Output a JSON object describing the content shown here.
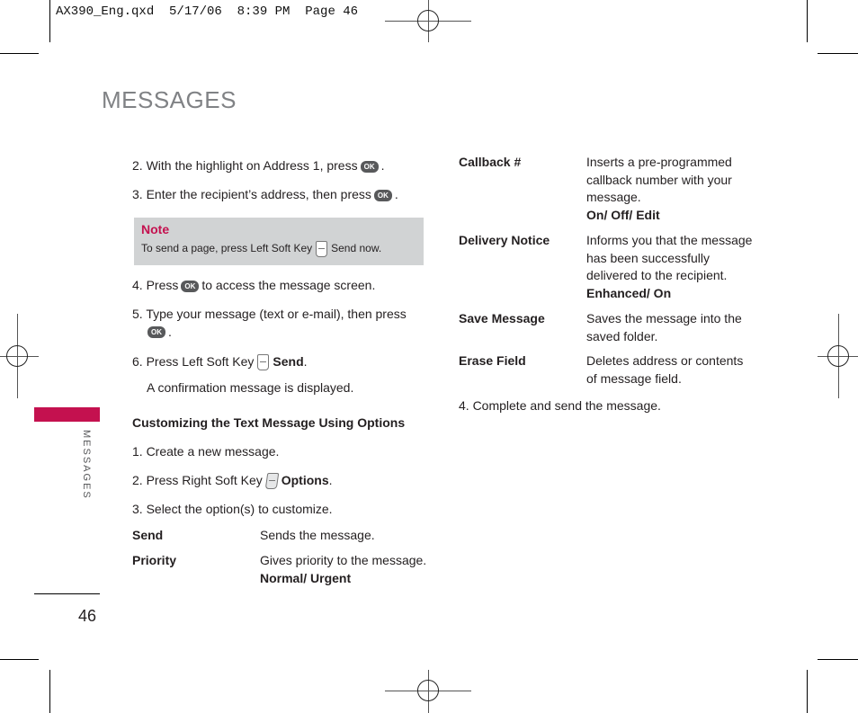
{
  "slug": "AX390_Eng.qxd  5/17/06  8:39 PM  Page 46",
  "page_title": "MESSAGES",
  "left": {
    "step2": {
      "text": "2. With the highlight on Address 1, press",
      "key": "OK",
      "end": "."
    },
    "step3": {
      "text": "3. Enter the recipient’s address, then press",
      "key": "OK",
      "end": "."
    },
    "note": {
      "title": "Note",
      "before": "To send a page, press Left Soft Key",
      "after": "Send now."
    },
    "step4": {
      "before": "4. Press",
      "key": "OK",
      "after": "to access the message screen."
    },
    "step5": {
      "text": "5. Type your message (text or e-mail), then press",
      "key": "OK",
      "end": "."
    },
    "step6": {
      "before": "6. Press Left Soft Key",
      "bold": "Send",
      "end": "."
    },
    "step6_sub": "A confirmation message is displayed.",
    "section_heading": "Customizing the Text Message Using Options",
    "c1": "1. Create a new message.",
    "c2": {
      "before": "2. Press Right Soft Key",
      "bold": "Options",
      "end": "."
    },
    "c3": "3. Select the option(s) to customize.",
    "options": [
      {
        "term": "Send",
        "desc": "Sends the message.",
        "values": ""
      },
      {
        "term": "Priority",
        "desc": "Gives priority to the message.",
        "values": "Normal/ Urgent"
      }
    ]
  },
  "right": {
    "options": [
      {
        "term": "Callback #",
        "desc": "Inserts a pre-programmed callback number with your message.",
        "values": "On/ Off/ Edit"
      },
      {
        "term": "Delivery Notice",
        "desc": "Informs you that the message has been successfully delivered to the recipient.",
        "values": "Enhanced/ On"
      },
      {
        "term": "Save Message",
        "desc": "Saves the message into the saved folder.",
        "values": ""
      },
      {
        "term": "Erase Field",
        "desc": "Deletes address or contents of message field.",
        "values": ""
      }
    ],
    "step4": "4. Complete and send the message."
  },
  "side_tab": "MESSAGES",
  "page_number": "46",
  "colors": {
    "accent": "#c4114f",
    "note_bg": "#d1d3d4",
    "title_gray": "#808285"
  }
}
